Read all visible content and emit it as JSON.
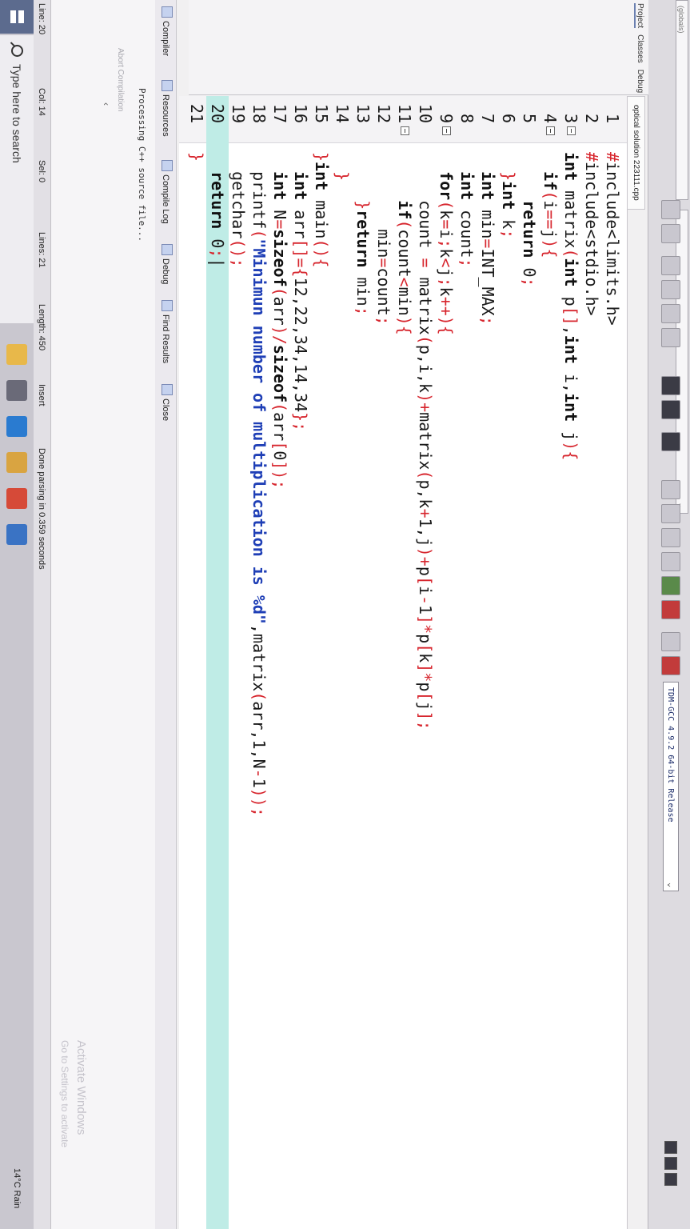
{
  "toolbar": {
    "compiler": "TDM-GCC 4.9.2 64-bit Release",
    "globals": "(globals)"
  },
  "project_panel": {
    "tabs": [
      "Project",
      "Classes",
      "Debug"
    ]
  },
  "editor": {
    "file_tab": "optical solution 223111.cpp",
    "current_line": 20,
    "lines": [
      {
        "n": "1",
        "fold": false,
        "html": "<span class=\"sym\">#</span>include&lt;limits.h&gt;"
      },
      {
        "n": "2",
        "fold": false,
        "html": "<span class=\"sym\">#</span>include&lt;stdio.h&gt;"
      },
      {
        "n": "3",
        "fold": true,
        "html": "<span class=\"kw\">int</span> matrix<span class=\"sym\">(</span><span class=\"kw\">int</span> p<span class=\"sym\">[]</span>,<span class=\"kw\">int</span> i,<span class=\"kw\">int</span> j<span class=\"sym\">){</span>"
      },
      {
        "n": "4",
        "fold": true,
        "html": "  <span class=\"kw\">if</span><span class=\"sym\">(</span>i<span class=\"sym\">==</span>j<span class=\"sym\">){</span>"
      },
      {
        "n": "5",
        "fold": false,
        "html": "     <span class=\"kw\">return</span> 0<span class=\"sym\">;</span>"
      },
      {
        "n": "6",
        "fold": false,
        "html": "  <span class=\"sym\">}</span><span class=\"kw\">int</span> k<span class=\"sym\">;</span>"
      },
      {
        "n": "7",
        "fold": false,
        "html": "  <span class=\"kw\">int</span> min<span class=\"sym\">=</span>INT_MAX<span class=\"sym\">;</span>"
      },
      {
        "n": "8",
        "fold": false,
        "html": "  <span class=\"kw\">int</span> count<span class=\"sym\">;</span>"
      },
      {
        "n": "9",
        "fold": true,
        "html": "  <span class=\"kw\">for</span><span class=\"sym\">(</span>k<span class=\"sym\">=</span>i<span class=\"sym\">;</span>k<span class=\"sym\">&lt;</span>j<span class=\"sym\">;</span>k<span class=\"sym\">++){</span>"
      },
      {
        "n": "10",
        "fold": false,
        "html": "     count <span class=\"sym\">=</span> matrix<span class=\"sym\">(</span>p,i,k<span class=\"sym\">)+</span>matrix<span class=\"sym\">(</span>p,k<span class=\"sym\">+</span>1,j<span class=\"sym\">)+</span>p<span class=\"sym\">[</span>i<span class=\"sym\">-</span>1<span class=\"sym\">]*</span>p<span class=\"sym\">[</span>k<span class=\"sym\">]*</span>p<span class=\"sym\">[</span>j<span class=\"sym\">];</span>"
      },
      {
        "n": "11",
        "fold": true,
        "html": "     <span class=\"kw\">if</span><span class=\"sym\">(</span>count<span class=\"sym\">&lt;</span>min<span class=\"sym\">){</span>"
      },
      {
        "n": "12",
        "fold": false,
        "html": "        min<span class=\"sym\">=</span>count<span class=\"sym\">;</span>"
      },
      {
        "n": "13",
        "fold": false,
        "html": "     <span class=\"sym\">}</span><span class=\"kw\">return</span> min<span class=\"sym\">;</span>"
      },
      {
        "n": "14",
        "fold": false,
        "html": "  <span class=\"sym\">}</span>"
      },
      {
        "n": "15",
        "fold": false,
        "html": "<span class=\"sym\">}</span><span class=\"kw\">int</span> main<span class=\"sym\">(){</span>"
      },
      {
        "n": "16",
        "fold": false,
        "html": "  <span class=\"kw\">int</span> arr<span class=\"sym\">[]={</span>12,22,34,14,34<span class=\"sym\">};</span>"
      },
      {
        "n": "17",
        "fold": false,
        "html": "  <span class=\"kw\">int</span> N<span class=\"sym\">=</span><span class=\"kw\">sizeof</span><span class=\"sym\">(</span>arr<span class=\"sym\">)/</span><span class=\"kw\">sizeof</span><span class=\"sym\">(</span>arr<span class=\"sym\">[</span>0<span class=\"sym\">]);</span>"
      },
      {
        "n": "18",
        "fold": false,
        "html": "  printf<span class=\"sym\">(</span><span class=\"str\">\"Minimun number of multiplication is %d\"</span>,matrix<span class=\"sym\">(</span>arr,1,N<span class=\"sym\">-</span>1<span class=\"sym\">));</span>"
      },
      {
        "n": "19",
        "fold": false,
        "html": "  getchar<span class=\"sym\">();</span>"
      },
      {
        "n": "20",
        "fold": false,
        "html": "  <span class=\"kw\">return</span> 0<span class=\"sym\">;</span><span class=\"caret\">|</span>"
      },
      {
        "n": "21",
        "fold": false,
        "html": "<span class=\"sym\">}</span>"
      }
    ]
  },
  "bottom_panel": {
    "tabs": [
      "Compiler",
      "Resources",
      "Compile Log",
      "Debug",
      "Find Results",
      "Close"
    ],
    "abort": "Abort Compilation",
    "message": "Processing C++ source file..."
  },
  "status_bar": {
    "line_label": "Line:",
    "line_value": "20",
    "col_label": "Col:",
    "col_value": "14",
    "sel_label": "Sel:",
    "sel_value": "0",
    "lines_label": "Lines:",
    "lines_value": "21",
    "length_label": "Length:",
    "length_value": "450",
    "mode": "Insert",
    "parse_message": "Done parsing in 0.359 seconds"
  },
  "taskbar": {
    "search_placeholder": "Type here to search",
    "weather": "14°C Rain"
  },
  "watermark": {
    "title": "Activate Windows",
    "subtitle": "Go to Settings to activate"
  }
}
